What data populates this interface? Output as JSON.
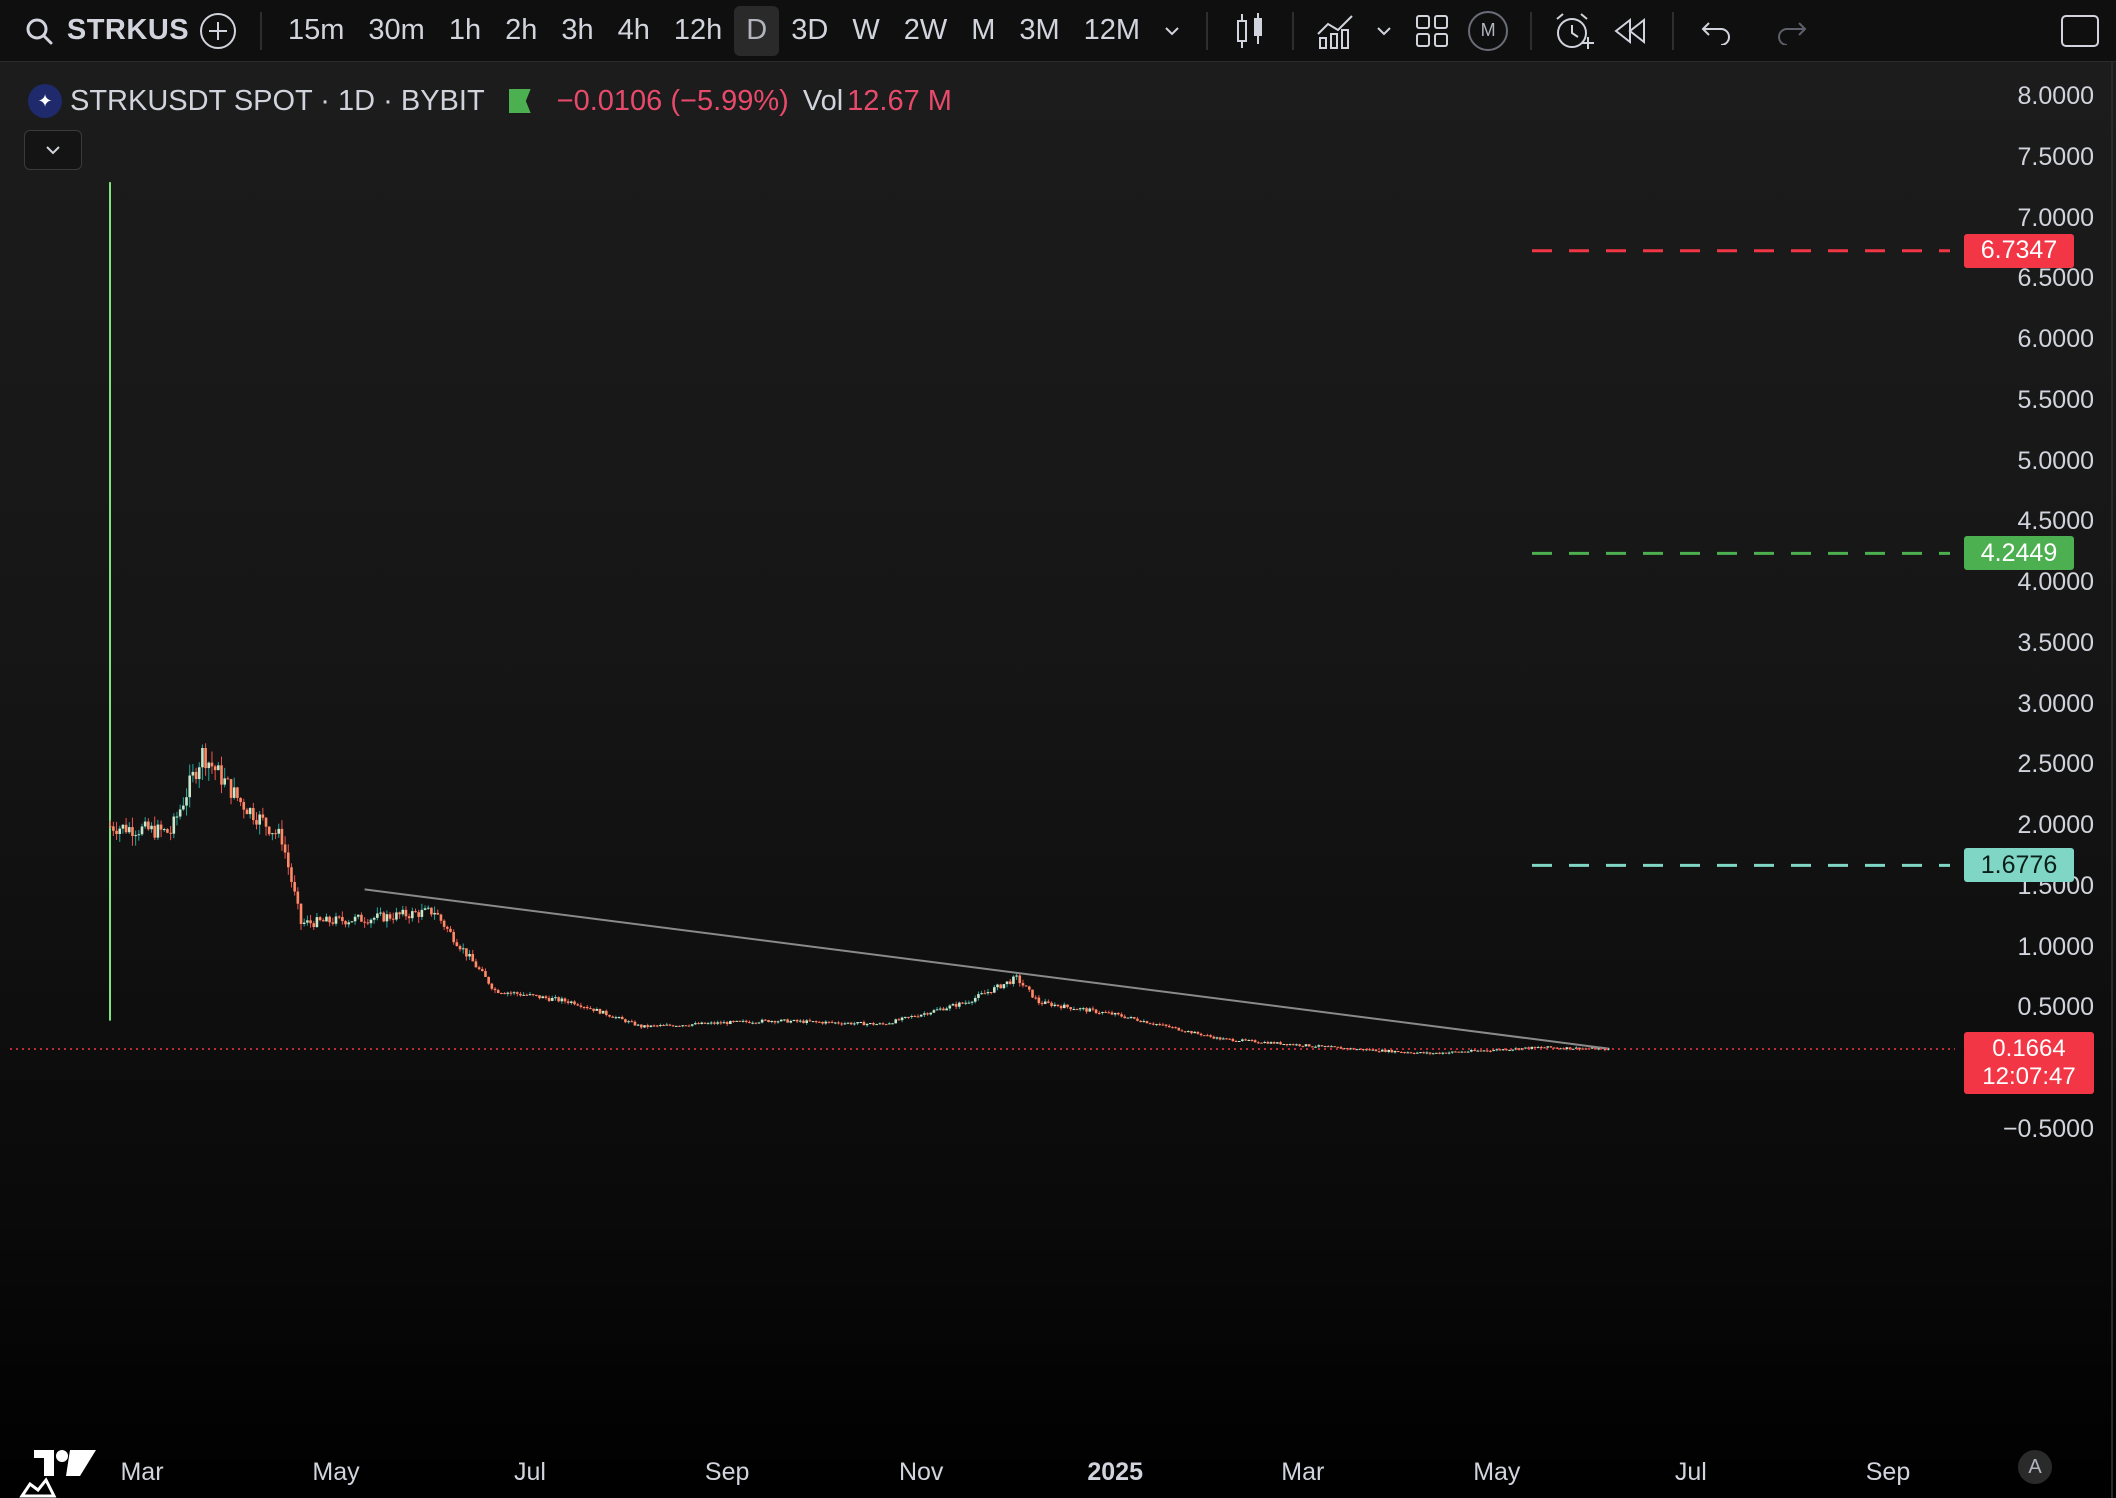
{
  "toolbar": {
    "symbol": "STRKUS",
    "intervals": [
      "15m",
      "30m",
      "1h",
      "2h",
      "3h",
      "4h",
      "12h",
      "D",
      "3D",
      "W",
      "2W",
      "M",
      "3M",
      "12M"
    ],
    "active_interval": "D",
    "m_badge": "M"
  },
  "legend": {
    "title": "STRKUSDT SPOT · 1D · BYBIT",
    "change": "−0.0106 (−5.99%)",
    "volume_label": "Vol",
    "volume_value": "12.67 M"
  },
  "price_axis": [
    "8.0000",
    "7.5000",
    "7.0000",
    "6.5000",
    "6.0000",
    "5.5000",
    "5.0000",
    "4.5000",
    "4.0000",
    "3.5000",
    "3.0000",
    "2.5000",
    "2.0000",
    "1.5000",
    "1.0000",
    "0.5000",
    "−0.5000"
  ],
  "time_axis": [
    {
      "label": "Mar",
      "bold": false
    },
    {
      "label": "May",
      "bold": false
    },
    {
      "label": "Jul",
      "bold": false
    },
    {
      "label": "Sep",
      "bold": false
    },
    {
      "label": "Nov",
      "bold": false
    },
    {
      "label": "2025",
      "bold": true
    },
    {
      "label": "Mar",
      "bold": false
    },
    {
      "label": "May",
      "bold": false
    },
    {
      "label": "Jul",
      "bold": false
    },
    {
      "label": "Sep",
      "bold": false
    }
  ],
  "levels": [
    {
      "value": "6.7347",
      "price": 6.7347,
      "color": "#f23645"
    },
    {
      "value": "4.2449",
      "price": 4.2449,
      "color": "#4caf50"
    },
    {
      "value": "1.6776",
      "price": 1.6776,
      "color": "#80d6c4"
    }
  ],
  "last_price": {
    "value": "0.1664",
    "countdown": "12:07:47",
    "price": 0.1664
  },
  "auto_button": "A",
  "colors": {
    "up": "#26a69a",
    "down": "#ef5350",
    "accent_red": "#f23645",
    "accent_green": "#4caf50"
  },
  "chart_data": {
    "type": "candlestick",
    "symbol": "STRKUSDT",
    "exchange": "BYBIT",
    "timeframe": "1D",
    "ylim": [
      -0.5,
      8.0
    ],
    "close_path": [
      {
        "date": "2024-02-20",
        "price": 2.0
      },
      {
        "date": "2024-03-10",
        "price": 1.95
      },
      {
        "date": "2024-03-20",
        "price": 2.6
      },
      {
        "date": "2024-04-01",
        "price": 2.2
      },
      {
        "date": "2024-04-14",
        "price": 1.9
      },
      {
        "date": "2024-04-20",
        "price": 1.2
      },
      {
        "date": "2024-05-15",
        "price": 1.25
      },
      {
        "date": "2024-06-01",
        "price": 1.3
      },
      {
        "date": "2024-06-05",
        "price": 1.15
      },
      {
        "date": "2024-06-20",
        "price": 0.65
      },
      {
        "date": "2024-07-15",
        "price": 0.55
      },
      {
        "date": "2024-08-05",
        "price": 0.35
      },
      {
        "date": "2024-09-15",
        "price": 0.4
      },
      {
        "date": "2024-10-20",
        "price": 0.37
      },
      {
        "date": "2024-11-15",
        "price": 0.55
      },
      {
        "date": "2024-12-01",
        "price": 0.75
      },
      {
        "date": "2024-12-08",
        "price": 0.55
      },
      {
        "date": "2025-01-01",
        "price": 0.45
      },
      {
        "date": "2025-02-03",
        "price": 0.25
      },
      {
        "date": "2025-03-15",
        "price": 0.17
      },
      {
        "date": "2025-04-10",
        "price": 0.13
      },
      {
        "date": "2025-05-15",
        "price": 0.18
      },
      {
        "date": "2025-06-05",
        "price": 0.166
      }
    ],
    "trendline": [
      {
        "date": "2024-05-10",
        "price": 1.48
      },
      {
        "date": "2025-06-05",
        "price": 0.17
      }
    ]
  }
}
